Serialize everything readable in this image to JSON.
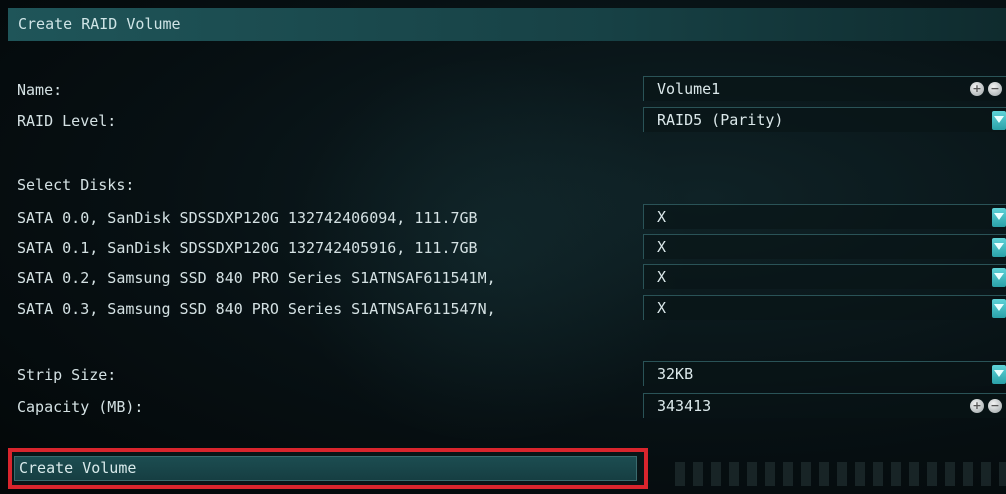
{
  "title": "Create RAID Volume",
  "name": {
    "label": "Name:",
    "value": "Volume1"
  },
  "raid_level": {
    "label": "RAID Level:",
    "value": "RAID5 (Parity)"
  },
  "select_disks": {
    "label": "Select Disks:",
    "disks": [
      {
        "label": "SATA 0.0, SanDisk SDSSDXP120G 132742406094, 111.7GB",
        "value": "X"
      },
      {
        "label": "SATA 0.1, SanDisk SDSSDXP120G 132742405916, 111.7GB",
        "value": "X"
      },
      {
        "label": "SATA 0.2, Samsung SSD 840 PRO Series S1ATNSAF611541M,",
        "value": "X"
      },
      {
        "label": "SATA 0.3, Samsung SSD 840 PRO Series S1ATNSAF611547N,",
        "value": "X"
      }
    ]
  },
  "strip_size": {
    "label": "Strip Size:",
    "value": "32KB"
  },
  "capacity": {
    "label": "Capacity (MB):",
    "value": "343413"
  },
  "create_button": "Create Volume",
  "colors": {
    "highlight": "#d9252d",
    "accent": "#3fbfc5"
  },
  "icons": {
    "dropdown": "chevron-down-icon",
    "increment": "plus-icon",
    "decrement": "minus-icon"
  }
}
